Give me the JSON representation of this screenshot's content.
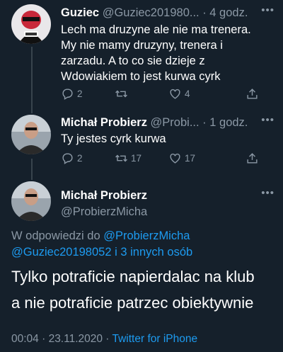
{
  "tweets": [
    {
      "name": "Guziec",
      "handle": "@Guziec201980...",
      "time": "· 4 godz.",
      "text_lines": [
        "Lech ma druzyne ale nie ma trenera.",
        "My nie mamy druzyny, trenera i",
        "zarzadu. A to co sie dzieje z",
        "Wdowiakiem to jest kurwa cyrk"
      ],
      "replies": "2",
      "retweets": "",
      "likes": "4"
    },
    {
      "name": "Michał Probierz",
      "handle": "@Probi...",
      "time": "· 1 godz.",
      "text_lines": [
        "Ty jestes cyrk kurwa"
      ],
      "replies": "2",
      "retweets": "17",
      "likes": "17"
    }
  ],
  "main": {
    "name": "Michał Probierz",
    "handle": "@ProbierzMicha",
    "reply_prefix": "W odpowiedzi do ",
    "reply_user1": "@ProbierzMicha",
    "reply_user2": "@Guziec20198052",
    "reply_more": " i 3 innych osób",
    "text_line1": "Tylko potraficie napierdalac na klub",
    "text_line2": "a nie potraficie patrzec obiektywnie",
    "time": "00:04",
    "date": " · 23.11.2020 · ",
    "source": "Twitter for iPhone"
  },
  "icons": {
    "more": "more-dots-icon",
    "reply": "reply-bubble-icon",
    "retweet": "retweet-icon",
    "like": "heart-icon",
    "share": "share-icon"
  },
  "colors": {
    "background": "#15202b",
    "secondary_text": "#8b98a5",
    "link": "#1d9bf0"
  }
}
